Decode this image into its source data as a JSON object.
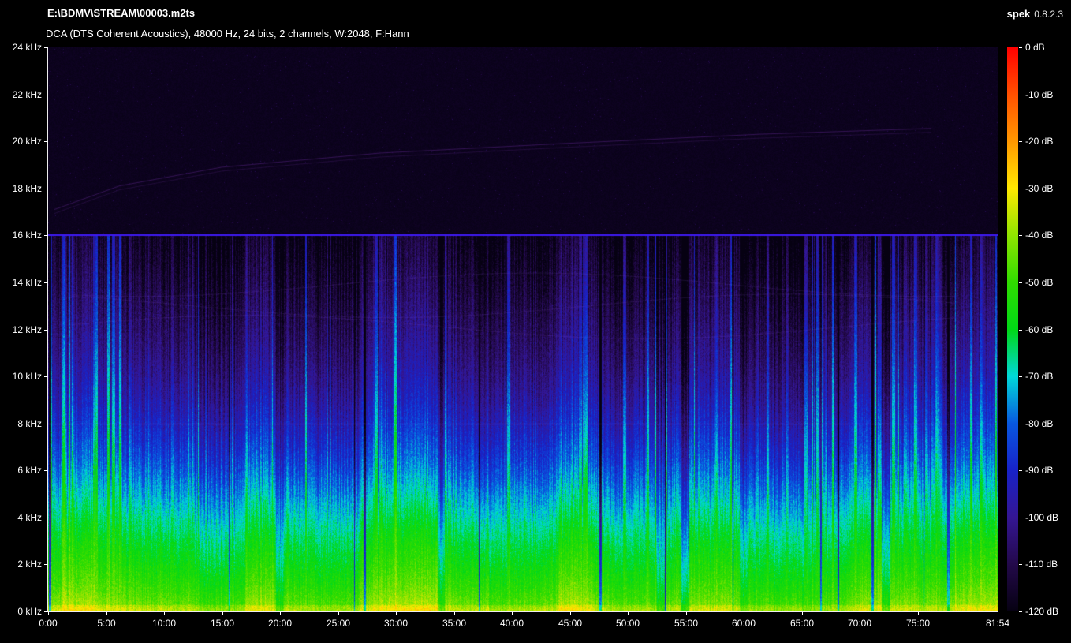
{
  "window": {
    "background": "#000000"
  },
  "header": {
    "title": "E:\\BDMV\\STREAM\\00003.m2ts",
    "subtitle": "DCA (DTS Coherent Acoustics), 48000 Hz, 24 bits, 2 channels, W:2048, F:Hann"
  },
  "brand": {
    "name": "spek",
    "version": "0.8.2.3"
  },
  "freq_axis": {
    "labels": [
      "24 kHz",
      "22 kHz",
      "20 kHz",
      "18 kHz",
      "16 kHz",
      "14 kHz",
      "12 kHz",
      "10 kHz",
      "8 kHz",
      "6 kHz",
      "4 kHz",
      "2 kHz",
      "0 kHz"
    ]
  },
  "time_axis": {
    "labels": [
      "0:00",
      "5:00",
      "10:00",
      "15:00",
      "20:00",
      "25:00",
      "30:00",
      "35:00",
      "40:00",
      "45:00",
      "50:00",
      "55:00",
      "60:00",
      "65:00",
      "70:00",
      "75:00"
    ],
    "end_label": "81:54"
  },
  "db_axis": {
    "labels": [
      "0 dB",
      "-10 dB",
      "-20 dB",
      "-30 dB",
      "-40 dB",
      "-50 dB",
      "-60 dB",
      "-70 dB",
      "-80 dB",
      "-90 dB",
      "-100 dB",
      "-110 dB",
      "-120 dB"
    ]
  },
  "chart_data": {
    "type": "heatmap",
    "subtype": "audio-spectrogram",
    "title": "E:\\BDMV\\STREAM\\00003.m2ts",
    "codec": "DCA (DTS Coherent Acoustics)",
    "sample_rate_hz": 48000,
    "bit_depth": 24,
    "channels": 2,
    "fft_window": "W:2048",
    "window_function": "F:Hann",
    "duration_label": "81:54",
    "x_axis": {
      "label": "time",
      "range_seconds": [
        0,
        4914
      ],
      "tick_interval_seconds": 300
    },
    "y_axis": {
      "label": "frequency",
      "range_khz": [
        0,
        24
      ],
      "tick_interval_khz": 2
    },
    "z_axis": {
      "label": "level",
      "range_db": [
        -120,
        0
      ],
      "tick_interval_db": 10
    },
    "legend_position": "right-colorbar",
    "grid": false,
    "palette_stops_db_hex": [
      [
        0,
        "#ff0000"
      ],
      [
        -10,
        "#ff5000"
      ],
      [
        -20,
        "#ff9800"
      ],
      [
        -30,
        "#ffe800"
      ],
      [
        -40,
        "#90e400"
      ],
      [
        -50,
        "#30dc00"
      ],
      [
        -60,
        "#00d816"
      ],
      [
        -70,
        "#00d8d8"
      ],
      [
        -80,
        "#0858e0"
      ],
      [
        -90,
        "#1822c8"
      ],
      [
        -100,
        "#341693"
      ],
      [
        -110,
        "#23094a"
      ],
      [
        -120,
        "#060112"
      ]
    ],
    "spectral_envelope_khz_db": [
      [
        0,
        -34
      ],
      [
        0.3,
        -40
      ],
      [
        1,
        -46
      ],
      [
        2,
        -52
      ],
      [
        3,
        -57
      ],
      [
        4,
        -63
      ],
      [
        5,
        -70
      ],
      [
        6,
        -77
      ],
      [
        7,
        -83
      ],
      [
        8,
        -88
      ],
      [
        9,
        -93
      ],
      [
        10,
        -97
      ],
      [
        12,
        -103
      ],
      [
        14,
        -109
      ],
      [
        16,
        -115
      ],
      [
        24,
        -120
      ]
    ],
    "macro_sections_min_offset_db": [
      [
        0,
        -3
      ],
      [
        1.2,
        0
      ],
      [
        4,
        -6
      ],
      [
        9.5,
        -3
      ],
      [
        13,
        -7
      ],
      [
        17,
        0
      ],
      [
        19.6,
        -13
      ],
      [
        20.3,
        -4
      ],
      [
        26.8,
        1
      ],
      [
        33.6,
        -15
      ],
      [
        34.2,
        -5
      ],
      [
        38,
        -8
      ],
      [
        44,
        -2
      ],
      [
        47,
        -5
      ],
      [
        52.5,
        -14
      ],
      [
        53.2,
        -3
      ],
      [
        54.6,
        -17
      ],
      [
        55.3,
        -2
      ],
      [
        59.6,
        -11
      ],
      [
        60.3,
        -5
      ],
      [
        65,
        -7
      ],
      [
        70,
        -3
      ],
      [
        71.9,
        -15
      ],
      [
        72.6,
        -5
      ],
      [
        78,
        -2
      ]
    ],
    "features": [
      "hard lowpass cutoff: content black above 16 kHz",
      "bright blue-violet horizontal line across full width at 16 kHz",
      "faint pale-violet horizontal line across full width at 8 kHz",
      "program-dependent vertical striations with occasional near-silent gap columns",
      "energy strongest below 4 kHz (green), cyan 4-6 kHz, blue 6-8 kHz, violet 8-16 kHz",
      "very faint rising harmonic trace from ~17 kHz to ~20.5 kHz across the file",
      "faint curved harmonic traces in the 11-14.5 kHz band"
    ]
  }
}
